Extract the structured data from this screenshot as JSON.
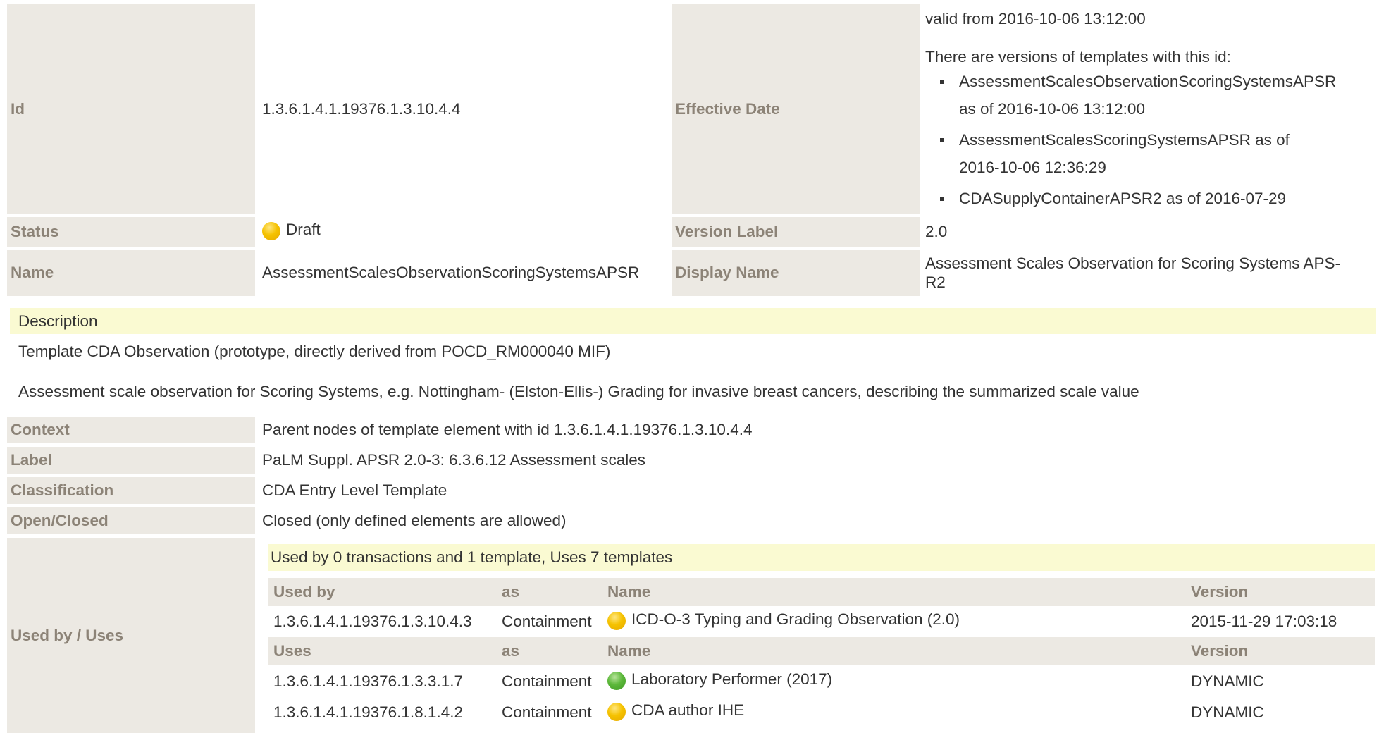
{
  "top": {
    "id_label": "Id",
    "id_value": "1.3.6.1.4.1.19376.1.3.10.4.4",
    "effective_date_label": "Effective Date",
    "valid_from": "valid from 2016-10-06 13:12:00",
    "versions_intro": "There are versions of templates with this id:",
    "versions": [
      {
        "line1": "AssessmentScalesObservationScoringSystemsAPSR",
        "line2": "as of 2016-10-06 13:12:00"
      },
      {
        "line1": "AssessmentScalesScoringSystemsAPSR as of",
        "line2": "2016-10-06 12:36:29"
      },
      {
        "line1": "CDASupplyContainerAPSR2 as of 2016-07-29",
        "line2": ""
      }
    ],
    "status_label": "Status",
    "status_value": "Draft",
    "version_label_label": "Version Label",
    "version_label_value": "2.0",
    "name_label": "Name",
    "name_value": "AssessmentScalesObservationScoringSystemsAPSR",
    "display_name_label": "Display Name",
    "display_name_line1": "Assessment Scales Observation for Scoring Systems APS-",
    "display_name_line2": "R2"
  },
  "description": {
    "heading": "Description",
    "para1": "Template CDA Observation (prototype, directly derived from POCD_RM000040 MIF)",
    "para2": "Assessment scale observation for Scoring Systems, e.g. Nottingham- (Elston-Ellis-) Grading for invasive breast cancers, describing the summarized scale value"
  },
  "meta": {
    "context_label": "Context",
    "context_value": "Parent nodes of template element with id 1.3.6.1.4.1.19376.1.3.10.4.4",
    "label_label": "Label",
    "label_value": "PaLM Suppl. APSR 2.0-3: 6.3.6.12 Assessment scales",
    "classification_label": "Classification",
    "classification_value": "CDA Entry Level Template",
    "open_closed_label": "Open/Closed",
    "open_closed_value": "Closed (only defined elements are allowed)",
    "used_by_uses_label": "Used by / Uses"
  },
  "usage": {
    "summary": "Used by 0 transactions and 1 template, Uses 7 templates",
    "used_by_header": {
      "col1": "Used by",
      "col2": "as",
      "col3": "Name",
      "col4": "Version"
    },
    "used_by_rows": [
      {
        "id": "1.3.6.1.4.1.19376.1.3.10.4.3",
        "as": "Containment",
        "status": "yellow",
        "name": "ICD-O-3 Typing and Grading Observation (2.0)",
        "version": "2015-11-29 17:03:18"
      }
    ],
    "uses_header": {
      "col1": "Uses",
      "col2": "as",
      "col3": "Name",
      "col4": "Version"
    },
    "uses_rows": [
      {
        "id": "1.3.6.1.4.1.19376.1.3.3.1.7",
        "as": "Containment",
        "status": "green",
        "name": "Laboratory Performer (2017)",
        "version": "DYNAMIC"
      },
      {
        "id": "1.3.6.1.4.1.19376.1.8.1.4.2",
        "as": "Containment",
        "status": "yellow",
        "name": "CDA author IHE",
        "version": "DYNAMIC"
      }
    ]
  },
  "colors": {
    "label_bg": "#ece9e3",
    "label_text": "#8c8377",
    "highlight_bg": "#fafad2",
    "draft_status": "#f5c200",
    "active_status": "#5cb83a"
  }
}
